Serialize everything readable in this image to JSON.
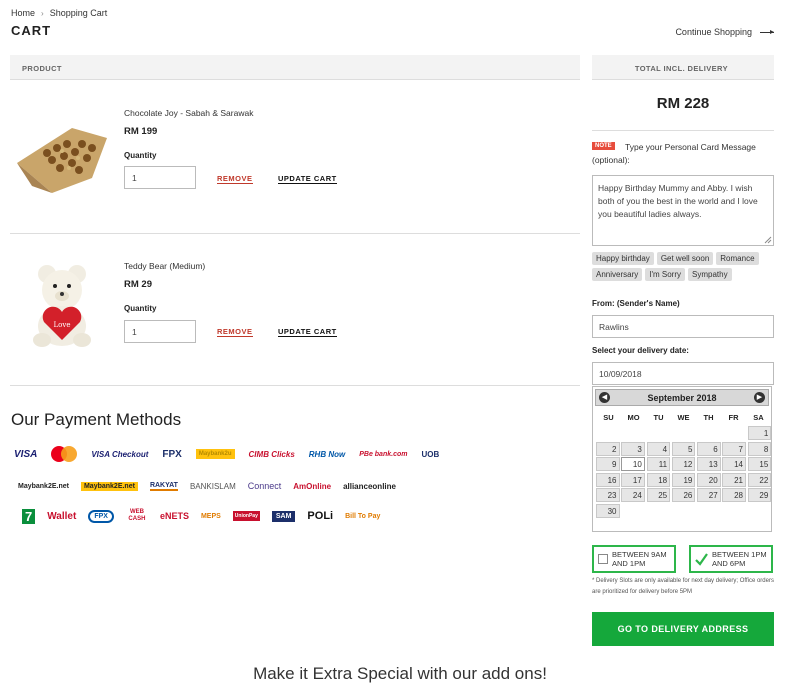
{
  "breadcrumb": {
    "home": "Home",
    "separator": "›",
    "current": "Shopping Cart"
  },
  "page_title": "CART",
  "continue_label": "Continue Shopping",
  "table": {
    "product_header": "PRODUCT",
    "total_header": "TOTAL INCL. DELIVERY"
  },
  "items": [
    {
      "name": "Chocolate Joy - Sabah & Sarawak",
      "price": "RM 199",
      "qty_label": "Quantity",
      "qty": "1",
      "remove": "REMOVE",
      "update": "UPDATE CART"
    },
    {
      "name": "Teddy Bear (Medium)",
      "price": "RM 29",
      "qty_label": "Quantity",
      "qty": "1",
      "remove": "REMOVE",
      "update": "UPDATE CART"
    }
  ],
  "payment": {
    "title": "Our Payment Methods",
    "row1": [
      {
        "label": "VISA",
        "color": "#1a1f71"
      },
      {
        "label": "MasterCard",
        "color": "#eb001b"
      },
      {
        "label": "VISA Checkout",
        "color": "#1a1f71"
      },
      {
        "label": "FPX",
        "color": "#1c2f6a"
      },
      {
        "label": "Maybank2u",
        "color": "#b58b00"
      },
      {
        "label": "CIMB Clicks",
        "color": "#c8102e"
      },
      {
        "label": "RHB Now",
        "color": "#0057a8"
      },
      {
        "label": "PBe bank.com",
        "color": "#c8102e"
      },
      {
        "label": "UOB",
        "color": "#1c2f6a"
      }
    ],
    "row2": [
      {
        "label": "Maybank2E.net",
        "color": "#222222"
      },
      {
        "label": "Maybank2E.net",
        "color": "#222222"
      },
      {
        "label": "RAKYAT",
        "color": "#1c2f6a"
      },
      {
        "label": "BANKISLAM",
        "color": "#555555"
      },
      {
        "label": "Connect",
        "color": "#4b3a8a"
      },
      {
        "label": "AmOnline",
        "color": "#c8102e"
      },
      {
        "label": "allianceonline",
        "color": "#222222"
      }
    ],
    "row3": [
      {
        "label": "7",
        "color": "#0a8f3c"
      },
      {
        "label": "Wallet",
        "color": "#c8102e"
      },
      {
        "label": "FPX",
        "color": "#0057a8"
      },
      {
        "label": "WEB CASH",
        "color": "#c8102e"
      },
      {
        "label": "eNETS",
        "color": "#c8102e"
      },
      {
        "label": "MEPS",
        "color": "#e07b00"
      },
      {
        "label": "UnionPay",
        "color": "#c8102e"
      },
      {
        "label": "SAM",
        "color": "#1c2f6a"
      },
      {
        "label": "POLi",
        "color": "#111111"
      },
      {
        "label": "Bill To Pay",
        "color": "#e07b00"
      }
    ]
  },
  "summary": {
    "total": "RM 228",
    "note_badge": "NOTE",
    "note_text": "Type your Personal Card Message (optional):",
    "message": "Happy Birthday Mummy and Abby. I wish both of you the best in the world and I love you beautiful ladies always.",
    "tags": [
      "Happy birthday",
      "Get well soon",
      "Romance",
      "Anniversary",
      "I'm Sorry",
      "Sympathy"
    ],
    "sender_label": "From: (Sender's Name)",
    "sender_value": "Rawlins",
    "date_label": "Select your delivery date:",
    "date_value": "10/09/2018",
    "slot1": "BETWEEN 9AM AND 1PM",
    "slot2": "BETWEEN 1PM AND 6PM",
    "slot_note": "* Delivery Slots are only available for next day delivery; Office orders are prioritized for delivery before 5PM",
    "cta": "GO TO DELIVERY ADDRESS"
  },
  "calendar": {
    "month": "September 2018",
    "prev": "◀",
    "next": "▶",
    "dows": [
      "SU",
      "MO",
      "TU",
      "WE",
      "TH",
      "FR",
      "SA"
    ],
    "lead_blanks": 6,
    "days": 30,
    "today": 10
  },
  "addons_title": "Make it Extra Special with our add ons!",
  "colors": {
    "accent_green": "#15a83b",
    "remove_red": "#c0392b",
    "note_red": "#e74c3c"
  }
}
